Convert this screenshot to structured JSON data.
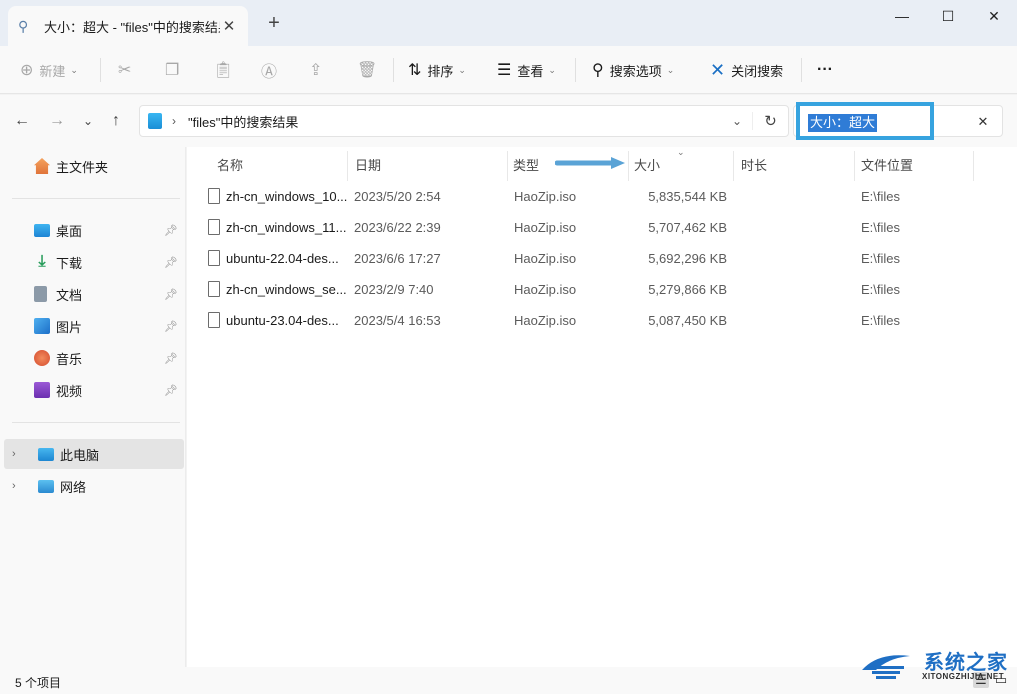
{
  "window": {
    "tab_title": "大小：超大 - \"files\"中的搜索结果",
    "tab_close": "✕",
    "new_tab": "+",
    "minimize": "—",
    "maximize": "☐",
    "close": "✕"
  },
  "toolbar": {
    "new": "新建",
    "sort": "排序",
    "view": "查看",
    "search_options": "搜索选项",
    "close_search": "关闭搜索",
    "more": "···"
  },
  "address": {
    "path": "\"files\"中的搜索结果",
    "search_query": "大小：超大",
    "search_clear": "✕"
  },
  "sidebar": {
    "home": "主文件夹",
    "quick": [
      {
        "label": "桌面",
        "icon": "desktop-icon"
      },
      {
        "label": "下载",
        "icon": "download-icon"
      },
      {
        "label": "文档",
        "icon": "documents-icon"
      },
      {
        "label": "图片",
        "icon": "pictures-icon"
      },
      {
        "label": "音乐",
        "icon": "music-icon"
      },
      {
        "label": "视频",
        "icon": "videos-icon"
      }
    ],
    "this_pc": "此电脑",
    "network": "网络"
  },
  "columns": {
    "name": "名称",
    "date": "日期",
    "type": "类型",
    "size": "大小",
    "length": "时长",
    "location": "文件位置"
  },
  "files": [
    {
      "name": "zh-cn_windows_10...",
      "date": "2023/5/20 2:54",
      "type": "HaoZip.iso",
      "size": "5,835,544 KB",
      "location": "E:\\files"
    },
    {
      "name": "zh-cn_windows_11...",
      "date": "2023/6/22 2:39",
      "type": "HaoZip.iso",
      "size": "5,707,462 KB",
      "location": "E:\\files"
    },
    {
      "name": "ubuntu-22.04-des...",
      "date": "2023/6/6 17:27",
      "type": "HaoZip.iso",
      "size": "5,692,296 KB",
      "location": "E:\\files"
    },
    {
      "name": "zh-cn_windows_se...",
      "date": "2023/2/9 7:40",
      "type": "HaoZip.iso",
      "size": "5,279,866 KB",
      "location": "E:\\files"
    },
    {
      "name": "ubuntu-23.04-des...",
      "date": "2023/5/4 16:53",
      "type": "HaoZip.iso",
      "size": "5,087,450 KB",
      "location": "E:\\files"
    }
  ],
  "status": {
    "count": "5 个项目"
  },
  "watermark": {
    "name": "系统之家",
    "url": "XITONGZHIJIA.NET"
  },
  "colors": {
    "accent": "#2f7cd6",
    "highlight_border": "#36a3df",
    "annotation_arrow": "#5aa3d6"
  }
}
